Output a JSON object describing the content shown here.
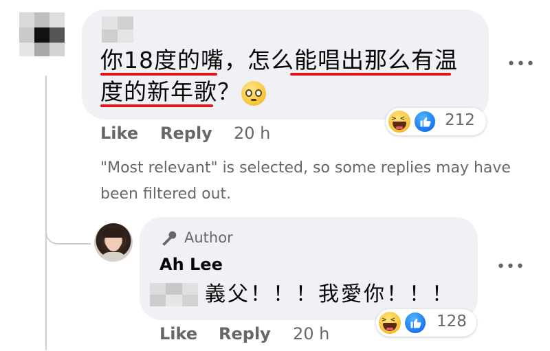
{
  "comment": {
    "text_line1": "你18度的嘴，怎么能唱出那么有温",
    "text_line2": "度的新年歌？",
    "emoji": "pleading-face-emoji",
    "more_label": "•••",
    "reactions": {
      "icons": [
        "haha-icon",
        "like-icon"
      ],
      "count": "212"
    },
    "actions": {
      "like": "Like",
      "reply": "Reply",
      "time": "20 h"
    },
    "highlight_color": "#e2141b"
  },
  "notice": "\"Most relevant\" is selected, so some replies may have been filtered out.",
  "reply": {
    "author_badge": "Author",
    "author_name": "Ah Lee",
    "text": "義父！！！我愛你！！！",
    "more_label": "•••",
    "reactions": {
      "icons": [
        "haha-icon",
        "like-icon"
      ],
      "count": "128"
    },
    "actions": {
      "like": "Like",
      "reply": "Reply",
      "time": "20 h"
    }
  },
  "colors": {
    "bubble_bg": "#eff1f5",
    "secondary_text": "#65676b",
    "like_blue": "#1877f2"
  }
}
